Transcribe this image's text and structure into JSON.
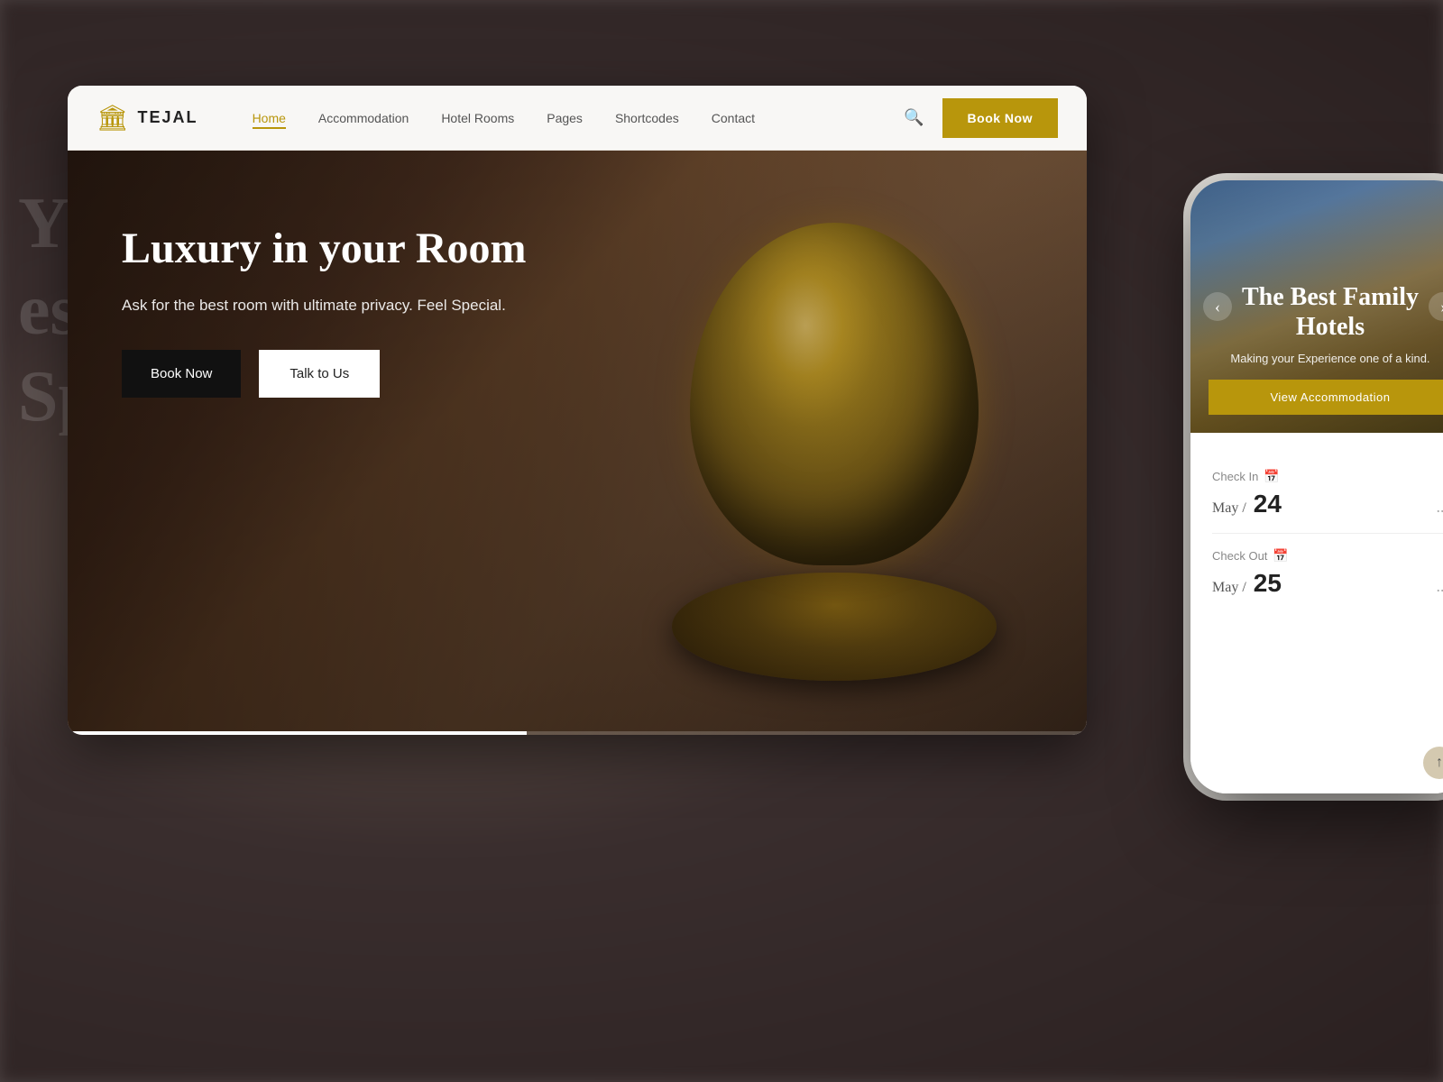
{
  "brand": {
    "logo_icon": "🏛",
    "logo_text": "TEJAL"
  },
  "navbar": {
    "links": [
      {
        "label": "Home",
        "active": true
      },
      {
        "label": "Accommodation",
        "active": false
      },
      {
        "label": "Hotel Rooms",
        "active": false
      },
      {
        "label": "Pages",
        "active": false
      },
      {
        "label": "Shortcodes",
        "active": false
      },
      {
        "label": "Contact",
        "active": false
      }
    ],
    "book_now": "Book Now"
  },
  "hero": {
    "title": "Luxury in your Room",
    "subtitle": "Ask for the best room with ultimate privacy. Feel Special.",
    "book_btn": "Book Now",
    "talk_btn": "Talk to Us"
  },
  "mobile": {
    "hero_title": "The Best Family Hotels",
    "hero_subtitle": "Making your Experience one of a kind.",
    "view_btn": "View Accommodation",
    "checkin": {
      "label": "Check In",
      "month": "May /",
      "day": "24",
      "dots": "..."
    },
    "checkout": {
      "label": "Check Out",
      "month": "May /",
      "day": "25",
      "dots": "..."
    },
    "scroll_up": "↑"
  },
  "colors": {
    "gold": "#b8960c",
    "dark": "#111111",
    "white": "#ffffff"
  }
}
